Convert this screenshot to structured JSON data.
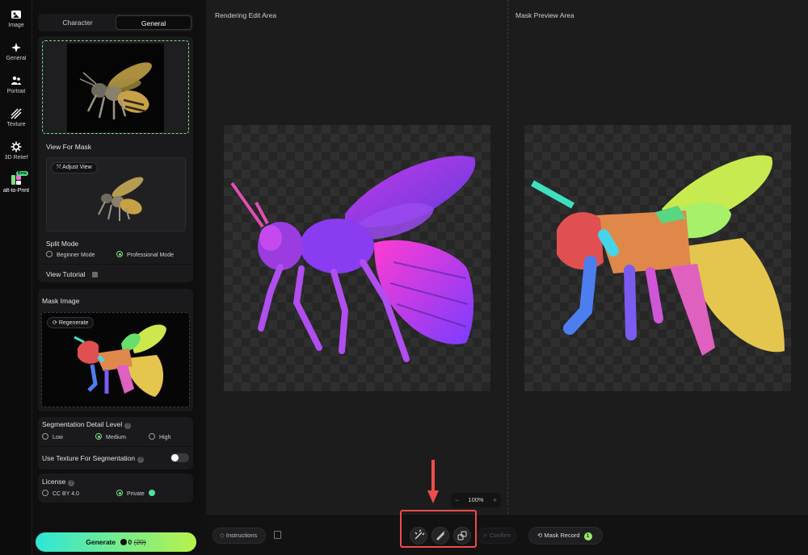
{
  "rail": {
    "items": [
      {
        "label": "Image",
        "icon": "image-icon"
      },
      {
        "label": "General",
        "icon": "sparkle-icon"
      },
      {
        "label": "Portrait",
        "icon": "people-icon"
      },
      {
        "label": "Texture",
        "icon": "texture-icon"
      },
      {
        "label": "3D Relief",
        "icon": "gear-icon"
      },
      {
        "label": "alt-to-Print",
        "icon": "print-icon",
        "badge": "Beta"
      }
    ]
  },
  "panel": {
    "tabs": [
      {
        "label": "Character"
      },
      {
        "label": "General"
      }
    ],
    "view_for_mask": "View For Mask",
    "adjust_view": "Adjust View",
    "split_mode": {
      "title": "Split Mode",
      "options": [
        "Beginner Mode",
        "Professional Mode"
      ],
      "selected": "Professional Mode"
    },
    "view_tutorial": "View Tutorial",
    "mask_image": "Mask Image",
    "regenerate": "Regenerate",
    "segmentation": {
      "title": "Segmentation Detail Level",
      "options": [
        "Low",
        "Medium",
        "High"
      ],
      "selected": "Medium"
    },
    "use_texture": {
      "label": "Use Texture For Segmentation",
      "enabled": false
    },
    "license": {
      "title": "License",
      "options": [
        "CC BY 4.0",
        "Private"
      ],
      "selected": "Private"
    },
    "generate": {
      "label": "Generate",
      "cost": "0",
      "original_cost": "(20)"
    }
  },
  "main": {
    "render_title": "Rendering Edit Area",
    "mask_title": "Mask Preview Area",
    "zoom": {
      "minus": "−",
      "value": "100%",
      "plus": "+"
    },
    "bottom": {
      "instructions": "Instructions",
      "confirm": "Confirm",
      "mask_record": "Mask Record",
      "mask_record_count": "1"
    }
  },
  "colors": {
    "accent_green": "#7be07b",
    "highlight_red": "#ef4b4b",
    "generate_from": "#2ee6d6",
    "generate_to": "#b7f24a"
  }
}
